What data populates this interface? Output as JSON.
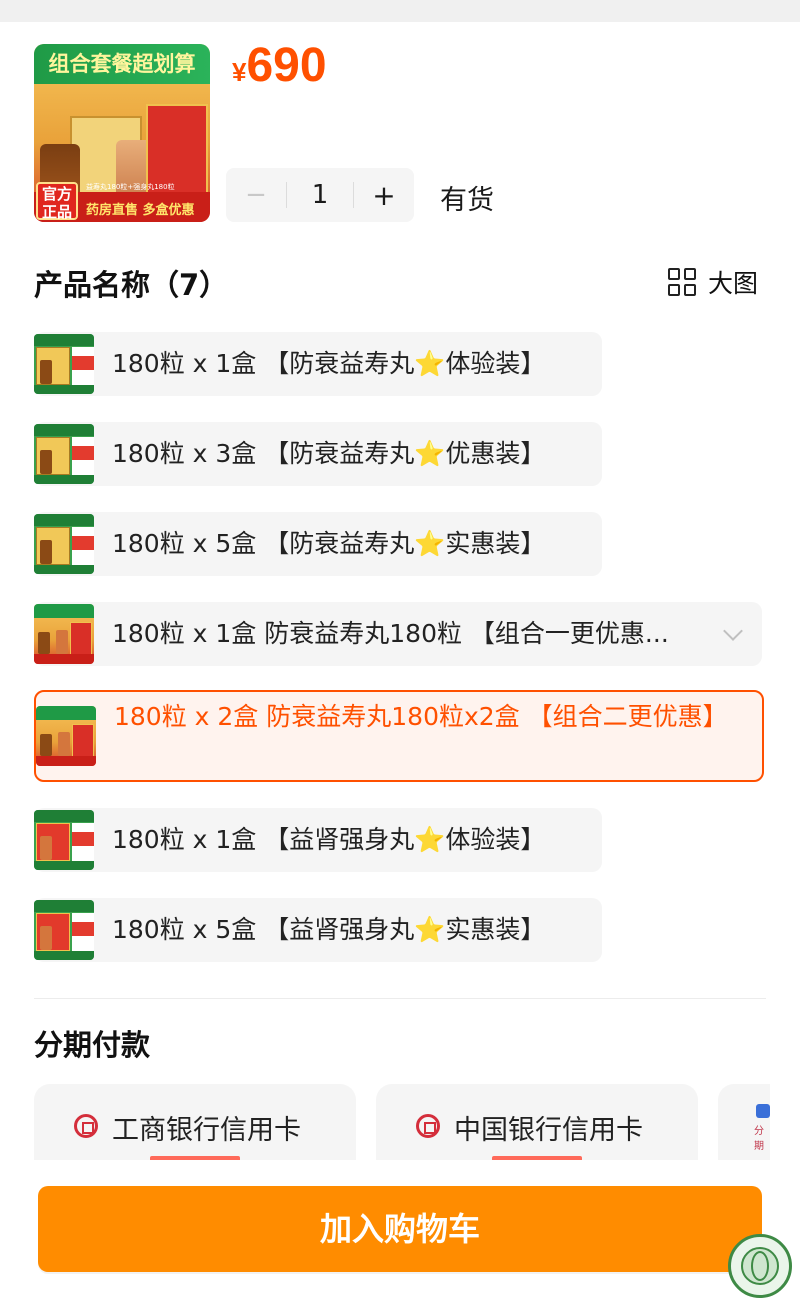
{
  "product": {
    "hero_banner_text": "组合套餐超划算",
    "hero_badge_text": "官方正品",
    "hero_bottom_text": "药房直售 多盒优惠",
    "hero_mini_text": "益寿丸180粒+强身丸180粒",
    "price_currency": "¥",
    "price_value": "690"
  },
  "quantity": {
    "minus": "−",
    "value": "1",
    "plus": "+",
    "stock_status": "有货"
  },
  "options_section": {
    "title": "产品名称（7）",
    "big_view_label": "大图",
    "items": [
      {
        "pre": "180粒 x 1盒 【防衰益寿丸",
        "star": "⭐",
        "post": "体验装】",
        "selected": false,
        "thumb": "green"
      },
      {
        "pre": "180粒 x 3盒 【防衰益寿丸",
        "star": "⭐",
        "post": "优惠装】",
        "selected": false,
        "thumb": "green"
      },
      {
        "pre": "180粒 x 5盒 【防衰益寿丸",
        "star": "⭐",
        "post": "实惠装】",
        "selected": false,
        "thumb": "green"
      },
      {
        "pre": "180粒 x 1盒 防衰益寿丸180粒 【组合一更优惠...",
        "star": "",
        "post": "",
        "selected": false,
        "thumb": "combo"
      },
      {
        "pre": "180粒 x 2盒 防衰益寿丸180粒x2盒 【组合二更优惠】",
        "star": "",
        "post": "",
        "selected": true,
        "thumb": "combo"
      },
      {
        "pre": "180粒 x 1盒 【益肾强身丸",
        "star": "⭐",
        "post": "体验装】",
        "selected": false,
        "thumb": "red"
      },
      {
        "pre": "180粒 x 5盒 【益肾强身丸",
        "star": "⭐",
        "post": "实惠装】",
        "selected": false,
        "thumb": "red"
      }
    ]
  },
  "installments": {
    "title": "分期付款",
    "banks": [
      {
        "name": "工商银行信用卡"
      },
      {
        "name": "中国银行信用卡"
      },
      {
        "name": "分期"
      }
    ]
  },
  "actions": {
    "add_to_cart": "加入购物车"
  },
  "colors": {
    "accent": "#ff5000",
    "cart_button": "#ff8c00"
  }
}
